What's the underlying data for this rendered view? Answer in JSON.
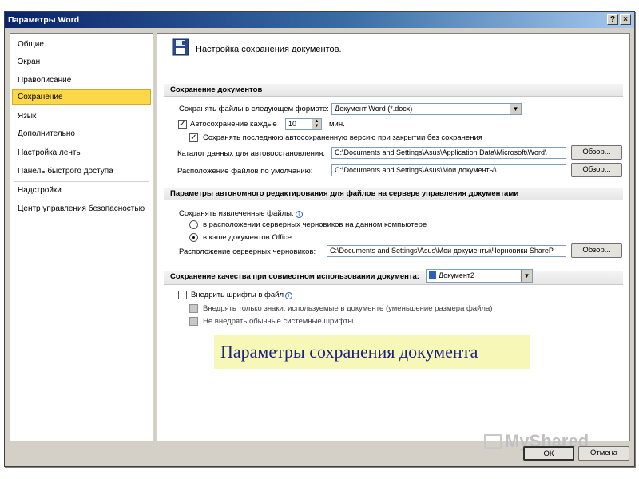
{
  "window": {
    "title": "Параметры Word",
    "help": "?",
    "close": "×"
  },
  "sidebar": {
    "items": [
      {
        "label": "Общие"
      },
      {
        "label": "Экран"
      },
      {
        "label": "Правописание"
      },
      {
        "label": "Сохранение",
        "active": true
      },
      {
        "label": "Язык"
      },
      {
        "label": "Дополнительно"
      },
      {
        "label": "Настройка ленты"
      },
      {
        "label": "Панель быстрого доступа"
      },
      {
        "label": "Надстройки"
      },
      {
        "label": "Центр управления безопасностью"
      }
    ]
  },
  "content": {
    "header": "Настройка сохранения документов.",
    "save_docs": {
      "section_title": "Сохранение документов",
      "format_label": "Сохранять файлы в следующем формате:",
      "format_value": "Документ Word (*.docx)",
      "autosave_label": "Автосохранение каждые",
      "autosave_value": "10",
      "autosave_unit": "мин.",
      "autosave_checked": true,
      "keep_last_label": "Сохранять последнюю автосохраненную версию при закрытии без сохранения",
      "keep_last_checked": true,
      "autorecover_label": "Каталог данных для автовосстановления:",
      "autorecover_value": "C:\\Documents and Settings\\Asus\\Application Data\\Microsoft\\Word\\",
      "default_location_label": "Расположение файлов по умолчанию:",
      "default_location_value": "C:\\Documents and Settings\\Asus\\Мои документы\\",
      "browse_label": "Обзор..."
    },
    "offline_editing": {
      "section_title": "Параметры автономного редактирования для файлов на сервере управления документами",
      "save_checked_out_label": "Сохранять извлеченные файлы:",
      "option_server_drafts": "в расположении серверных черновиков на данном компьютере",
      "option_office_cache": "в кэше документов Office",
      "server_drafts_label": "Расположение серверных черновиков:",
      "server_drafts_value": "C:\\Documents and Settings\\Asus\\Мои документы\\Черновики ShareP",
      "browse_label": "Обзор..."
    },
    "fidelity": {
      "section_title": "Сохранение качества при совместном использовании документа:",
      "document_value": "Документ2",
      "embed_fonts_label": "Внедрить шрифты в файл",
      "embed_only_used_label": "Внедрять только знаки, используемые в документе (уменьшение размера файла)",
      "no_common_fonts_label": "Не внедрять обычные системные шрифты"
    }
  },
  "banner": {
    "text": "Параметры сохранения документа"
  },
  "watermark": {
    "text": "MyShared"
  },
  "footer": {
    "ok_label": "ОК",
    "cancel_label": "Отмена"
  },
  "colors": {
    "active_nav": "#fbd848",
    "titlebar": "#0a246a",
    "banner_bg": "#f7f7b8",
    "banner_text": "#1a237e"
  }
}
